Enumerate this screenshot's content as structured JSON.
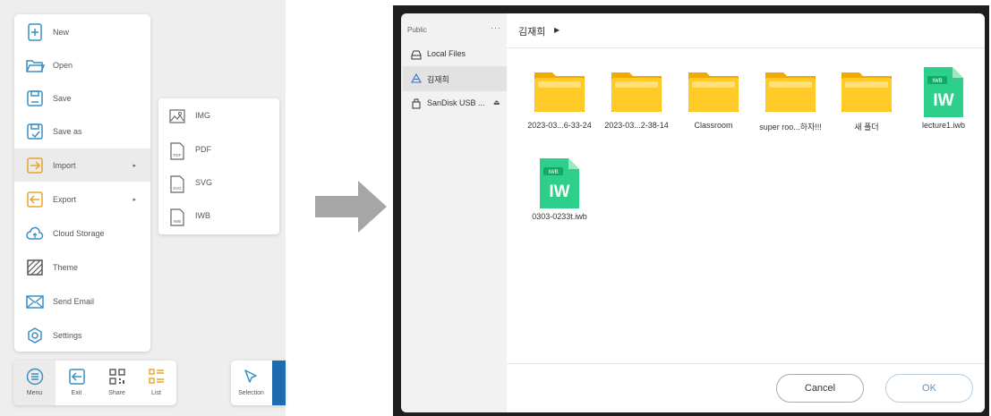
{
  "menu": {
    "items": [
      {
        "label": "New",
        "icon": "new-file-icon"
      },
      {
        "label": "Open",
        "icon": "folder-open-icon"
      },
      {
        "label": "Save",
        "icon": "save-icon"
      },
      {
        "label": "Save as",
        "icon": "save-as-icon"
      },
      {
        "label": "Import",
        "icon": "import-icon",
        "arrow": "▸"
      },
      {
        "label": "Export",
        "icon": "export-icon",
        "arrow": "▸"
      },
      {
        "label": "Cloud Storage",
        "icon": "cloud-storage-icon"
      },
      {
        "label": "Theme",
        "icon": "theme-icon"
      },
      {
        "label": "Send Email",
        "icon": "email-icon"
      },
      {
        "label": "Settings",
        "icon": "settings-icon"
      }
    ]
  },
  "submenu": {
    "items": [
      {
        "label": "IMG",
        "icon": "image-file-icon"
      },
      {
        "label": "PDF",
        "icon": "pdf-file-icon",
        "badge": "PDF"
      },
      {
        "label": "SVG",
        "icon": "svg-file-icon",
        "badge": "SVG"
      },
      {
        "label": "IWB",
        "icon": "iwb-file-icon",
        "badge": "IWB"
      }
    ]
  },
  "toolbar": {
    "items": [
      {
        "label": "Menu",
        "icon": "menu-icon"
      },
      {
        "label": "Exit",
        "icon": "exit-icon"
      },
      {
        "label": "Share",
        "icon": "qr-share-icon"
      },
      {
        "label": "List",
        "icon": "list-icon"
      }
    ],
    "selection": {
      "label": "Selection",
      "icon": "cursor-icon"
    }
  },
  "dialog": {
    "sidebar": {
      "heading": "Public",
      "more": "···",
      "items": [
        {
          "label": "Local Files",
          "icon": "drive-icon"
        },
        {
          "label": "김재희",
          "icon": "cloud-drive-icon"
        },
        {
          "label": "SanDisk USB ...",
          "icon": "usb-icon",
          "eject": "⏏"
        }
      ]
    },
    "breadcrumb": {
      "path": "김재희",
      "arrow": "▶"
    },
    "files": [
      {
        "name": "2023-03...6-33-24",
        "kind": "folder"
      },
      {
        "name": "2023-03...2-38-14",
        "kind": "folder"
      },
      {
        "name": "Classroom",
        "kind": "folder"
      },
      {
        "name": "super roo...하자!!!",
        "kind": "folder"
      },
      {
        "name": "새 폴더",
        "kind": "folder"
      },
      {
        "name": "lecture1.iwb",
        "kind": "iwb",
        "badge": "IWB",
        "mark": "IW"
      },
      {
        "name": "0303-0233t.iwb",
        "kind": "iwb",
        "badge": "IWB",
        "mark": "IW"
      }
    ],
    "buttons": {
      "cancel": "Cancel",
      "ok": "OK"
    }
  },
  "colors": {
    "folder": "#f5b800",
    "iwb_green": "#2ecf8b",
    "menu_accent": "#e8a32a",
    "selection_blue": "#1f6bb0"
  }
}
